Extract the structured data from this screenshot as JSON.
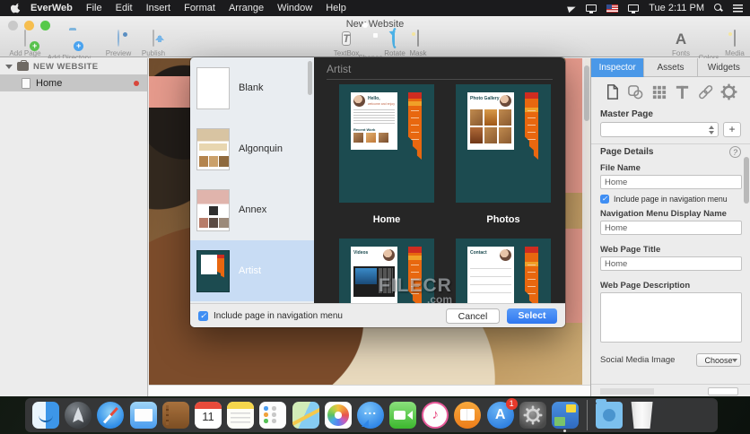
{
  "menubar": {
    "items": [
      "EverWeb",
      "File",
      "Edit",
      "Insert",
      "Format",
      "Arrange",
      "Window",
      "Help"
    ],
    "time": "Tue 2:11 PM"
  },
  "window": {
    "title": "New Website"
  },
  "toolbar": {
    "left": [
      "Add Page",
      "Add Directory",
      "Preview",
      "Publish"
    ],
    "center": [
      "TextBox",
      "Shapes",
      "Rotate",
      "Mask"
    ],
    "right": [
      "Fonts",
      "Colors",
      "Media"
    ]
  },
  "sidebar": {
    "site_name": "NEW WEBSITE",
    "pages": [
      {
        "label": "Home"
      }
    ]
  },
  "dialog": {
    "templates": [
      {
        "name": "Blank"
      },
      {
        "name": "Algonquin"
      },
      {
        "name": "Annex"
      },
      {
        "name": "Artist"
      }
    ],
    "selected_template": "Artist",
    "preview_title": "Artist",
    "pages": [
      {
        "label": "Home",
        "card_title": "Hello,",
        "card_subtitle": "welcome and enjoy",
        "card_section": "Recent Work"
      },
      {
        "label": "Photos",
        "card_title": "Photo Gallery"
      },
      {
        "label": "Videos",
        "card_title": "Videos"
      },
      {
        "label": "Contact",
        "card_title": "Contact"
      }
    ],
    "nav_checkbox_label": "Include page in navigation menu",
    "checkbox_checked": "✓",
    "cancel_label": "Cancel",
    "select_label": "Select"
  },
  "watermark": {
    "main": "FILECR",
    "suffix": ".com"
  },
  "inspector": {
    "tabs": [
      "Inspector",
      "Assets",
      "Widgets"
    ],
    "active_tab": "Inspector",
    "master_page_label": "Master Page",
    "add_master_button": "+",
    "page_details_label": "Page Details",
    "help_glyph": "?",
    "file_name_label": "File Name",
    "file_name_value": "Home",
    "nav_checkbox_label": "Include page in navigation menu",
    "nav_display_label": "Navigation Menu Display Name",
    "nav_display_value": "Home",
    "web_title_label": "Web Page Title",
    "web_title_value": "Home",
    "web_desc_label": "Web Page Description",
    "web_desc_value": "",
    "social_image_label": "Social Media Image",
    "choose_button_label": "Choose"
  },
  "dock": {
    "calendar_day": "11",
    "app_store_badge": "1",
    "itunes_note": "♪",
    "app_store_letter": "A"
  },
  "colors": {
    "accent_blue": "#3f8ef3",
    "inspector_tab_blue": "#4a98e8",
    "artist_teal": "#1c4b50",
    "ribbon_red": "#cf2c20",
    "ribbon_orange": "#e8670f",
    "canvas_salmon": "#e59a8c",
    "select_button_blue": "#2f77f0"
  }
}
